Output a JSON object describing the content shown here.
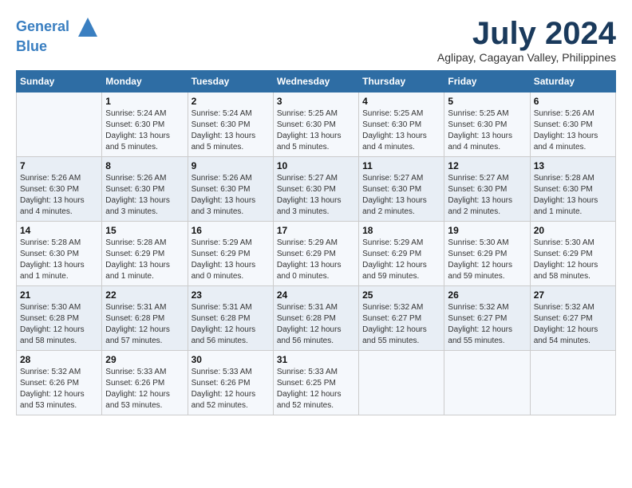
{
  "header": {
    "logo_line1": "General",
    "logo_line2": "Blue",
    "month_title": "July 2024",
    "location": "Aglipay, Cagayan Valley, Philippines"
  },
  "days_of_week": [
    "Sunday",
    "Monday",
    "Tuesday",
    "Wednesday",
    "Thursday",
    "Friday",
    "Saturday"
  ],
  "weeks": [
    [
      {
        "day": "",
        "info": ""
      },
      {
        "day": "1",
        "info": "Sunrise: 5:24 AM\nSunset: 6:30 PM\nDaylight: 13 hours\nand 5 minutes."
      },
      {
        "day": "2",
        "info": "Sunrise: 5:24 AM\nSunset: 6:30 PM\nDaylight: 13 hours\nand 5 minutes."
      },
      {
        "day": "3",
        "info": "Sunrise: 5:25 AM\nSunset: 6:30 PM\nDaylight: 13 hours\nand 5 minutes."
      },
      {
        "day": "4",
        "info": "Sunrise: 5:25 AM\nSunset: 6:30 PM\nDaylight: 13 hours\nand 4 minutes."
      },
      {
        "day": "5",
        "info": "Sunrise: 5:25 AM\nSunset: 6:30 PM\nDaylight: 13 hours\nand 4 minutes."
      },
      {
        "day": "6",
        "info": "Sunrise: 5:26 AM\nSunset: 6:30 PM\nDaylight: 13 hours\nand 4 minutes."
      }
    ],
    [
      {
        "day": "7",
        "info": "Sunrise: 5:26 AM\nSunset: 6:30 PM\nDaylight: 13 hours\nand 4 minutes."
      },
      {
        "day": "8",
        "info": "Sunrise: 5:26 AM\nSunset: 6:30 PM\nDaylight: 13 hours\nand 3 minutes."
      },
      {
        "day": "9",
        "info": "Sunrise: 5:26 AM\nSunset: 6:30 PM\nDaylight: 13 hours\nand 3 minutes."
      },
      {
        "day": "10",
        "info": "Sunrise: 5:27 AM\nSunset: 6:30 PM\nDaylight: 13 hours\nand 3 minutes."
      },
      {
        "day": "11",
        "info": "Sunrise: 5:27 AM\nSunset: 6:30 PM\nDaylight: 13 hours\nand 2 minutes."
      },
      {
        "day": "12",
        "info": "Sunrise: 5:27 AM\nSunset: 6:30 PM\nDaylight: 13 hours\nand 2 minutes."
      },
      {
        "day": "13",
        "info": "Sunrise: 5:28 AM\nSunset: 6:30 PM\nDaylight: 13 hours\nand 1 minute."
      }
    ],
    [
      {
        "day": "14",
        "info": "Sunrise: 5:28 AM\nSunset: 6:30 PM\nDaylight: 13 hours\nand 1 minute."
      },
      {
        "day": "15",
        "info": "Sunrise: 5:28 AM\nSunset: 6:29 PM\nDaylight: 13 hours\nand 1 minute."
      },
      {
        "day": "16",
        "info": "Sunrise: 5:29 AM\nSunset: 6:29 PM\nDaylight: 13 hours\nand 0 minutes."
      },
      {
        "day": "17",
        "info": "Sunrise: 5:29 AM\nSunset: 6:29 PM\nDaylight: 13 hours\nand 0 minutes."
      },
      {
        "day": "18",
        "info": "Sunrise: 5:29 AM\nSunset: 6:29 PM\nDaylight: 12 hours\nand 59 minutes."
      },
      {
        "day": "19",
        "info": "Sunrise: 5:30 AM\nSunset: 6:29 PM\nDaylight: 12 hours\nand 59 minutes."
      },
      {
        "day": "20",
        "info": "Sunrise: 5:30 AM\nSunset: 6:29 PM\nDaylight: 12 hours\nand 58 minutes."
      }
    ],
    [
      {
        "day": "21",
        "info": "Sunrise: 5:30 AM\nSunset: 6:28 PM\nDaylight: 12 hours\nand 58 minutes."
      },
      {
        "day": "22",
        "info": "Sunrise: 5:31 AM\nSunset: 6:28 PM\nDaylight: 12 hours\nand 57 minutes."
      },
      {
        "day": "23",
        "info": "Sunrise: 5:31 AM\nSunset: 6:28 PM\nDaylight: 12 hours\nand 56 minutes."
      },
      {
        "day": "24",
        "info": "Sunrise: 5:31 AM\nSunset: 6:28 PM\nDaylight: 12 hours\nand 56 minutes."
      },
      {
        "day": "25",
        "info": "Sunrise: 5:32 AM\nSunset: 6:27 PM\nDaylight: 12 hours\nand 55 minutes."
      },
      {
        "day": "26",
        "info": "Sunrise: 5:32 AM\nSunset: 6:27 PM\nDaylight: 12 hours\nand 55 minutes."
      },
      {
        "day": "27",
        "info": "Sunrise: 5:32 AM\nSunset: 6:27 PM\nDaylight: 12 hours\nand 54 minutes."
      }
    ],
    [
      {
        "day": "28",
        "info": "Sunrise: 5:32 AM\nSunset: 6:26 PM\nDaylight: 12 hours\nand 53 minutes."
      },
      {
        "day": "29",
        "info": "Sunrise: 5:33 AM\nSunset: 6:26 PM\nDaylight: 12 hours\nand 53 minutes."
      },
      {
        "day": "30",
        "info": "Sunrise: 5:33 AM\nSunset: 6:26 PM\nDaylight: 12 hours\nand 52 minutes."
      },
      {
        "day": "31",
        "info": "Sunrise: 5:33 AM\nSunset: 6:25 PM\nDaylight: 12 hours\nand 52 minutes."
      },
      {
        "day": "",
        "info": ""
      },
      {
        "day": "",
        "info": ""
      },
      {
        "day": "",
        "info": ""
      }
    ]
  ]
}
